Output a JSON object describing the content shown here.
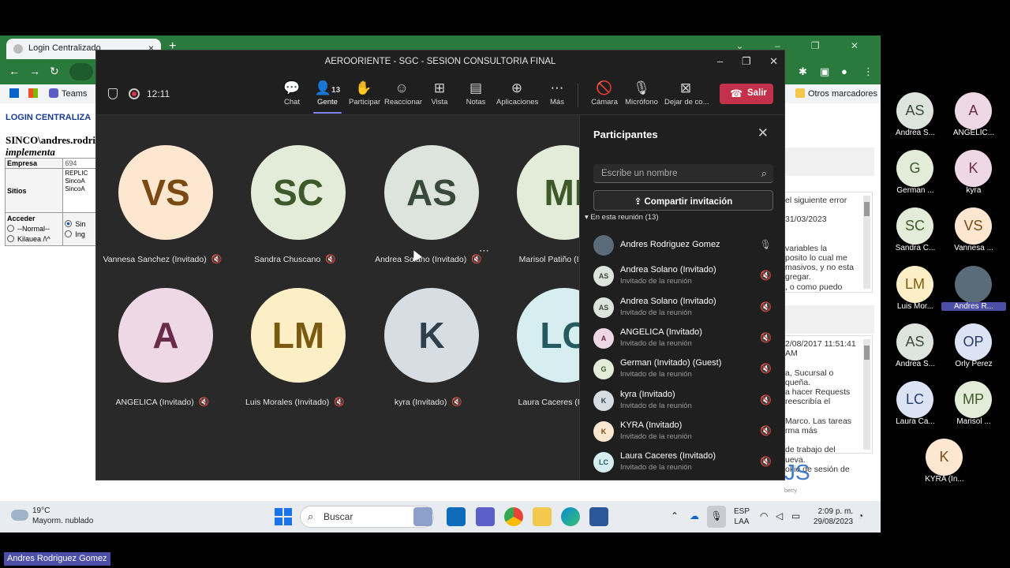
{
  "browser": {
    "tab_title": "Login Centralizado",
    "tab_close": "×",
    "new_tab": "+",
    "bookmarks": {
      "teams": "Teams",
      "otros": "Otros marcadores"
    }
  },
  "page": {
    "login_title": "LOGIN CENTRALIZA",
    "user_line": "SINCO\\andres.rodri",
    "implementa": "implementa",
    "empresa_label": "Empresa",
    "empresa_value": "694",
    "sitios_label": "Sitios",
    "sitios_values": [
      "REPLIC",
      "SincoA",
      "SincoA"
    ],
    "acceder_label": "Acceder",
    "opt_normal": "--Normal--",
    "opt_kilauea": "Kilauea /\\^",
    "opt_sin": "Sin",
    "opt_ing": "Ing",
    "right_text_1": [
      "el siguiente error",
      "",
      "31/03/2023",
      "",
      "",
      "variables la",
      "posito lo cual me",
      "masivos, y no esta",
      "gregar.",
      ", o como puedo"
    ],
    "right_text_2": [
      "2/08/2017 11:51:41 AM",
      "",
      "a, Sucursal o",
      "queña.",
      "a hacer Requests",
      "reescribía el",
      "",
      "Marco. Las tareas",
      "rma más",
      "",
      "de trabajo del",
      "ueva.",
      "okie de sesión de"
    ],
    "logo_fragment": "JS",
    "logo_sub": "berry"
  },
  "taskbar": {
    "weather_temp": "19°C",
    "weather_desc": "Mayorm. nublado",
    "search_label": "Buscar",
    "lang_1": "ESP",
    "lang_2": "LAA",
    "time": "2:09 p. m.",
    "date": "29/08/2023"
  },
  "teams": {
    "window_title": "AEROORIENTE - SGC - SESION CONSULTORIA FINAL",
    "timer": "12:11",
    "people_count": "13",
    "toolbar": {
      "chat": "Chat",
      "gente": "Gente",
      "participar": "Participar",
      "reaccionar": "Reaccionar",
      "vista": "Vista",
      "notas": "Notas",
      "aplicaciones": "Aplicaciones",
      "mas": "Más",
      "camara": "Cámara",
      "microfono": "Micrófono",
      "dejar": "Dejar de co...",
      "salir": "Salir"
    },
    "tiles": [
      {
        "initials": "VS",
        "name": "Vannesa Sanchez (Invitado)",
        "bg": "#fde7d0",
        "fg": "#7a4a12"
      },
      {
        "initials": "SC",
        "name": "Sandra Chuscano",
        "bg": "#e3ecd9",
        "fg": "#3f5a2a"
      },
      {
        "initials": "AS",
        "name": "Andrea Solano (Invitado)",
        "bg": "#dde4dd",
        "fg": "#3a4a3a"
      },
      {
        "initials": "MI",
        "name": "Marisol Patiño (Inv",
        "bg": "#e3ecd9",
        "fg": "#3f5a2a"
      },
      {
        "initials": "A",
        "name": "ANGELICA (Invitado)",
        "bg": "#efd8e6",
        "fg": "#6a2a4a"
      },
      {
        "initials": "LM",
        "name": "Luis Morales (Invitado)",
        "bg": "#fcefc6",
        "fg": "#7a5a10"
      },
      {
        "initials": "K",
        "name": "kyra (Invitado)",
        "bg": "#d6dde3",
        "fg": "#2f3f4c"
      },
      {
        "initials": "LC",
        "name": "Laura Caceres (Inv",
        "bg": "#d7eef0",
        "fg": "#245a60"
      }
    ],
    "panel": {
      "title": "Participantes",
      "search_placeholder": "Escribe un nombre",
      "invite": "Compartir invitación",
      "in_meeting": "En esta reunión (13)",
      "role": "Invitado de la reunión",
      "participants": [
        {
          "initials": "",
          "name": "Andres Rodriguez Gomez",
          "show_role": false,
          "bg": "#5a6b7a",
          "fg": "#fff",
          "muted": false
        },
        {
          "initials": "AS",
          "name": "Andrea Solano (Invitado)",
          "show_role": true,
          "bg": "#dde4dd",
          "fg": "#3a4a3a",
          "muted": true
        },
        {
          "initials": "AS",
          "name": "Andrea Solano (Invitado)",
          "show_role": true,
          "bg": "#dde4dd",
          "fg": "#3a4a3a",
          "muted": true
        },
        {
          "initials": "A",
          "name": "ANGELICA (Invitado)",
          "show_role": true,
          "bg": "#efd8e6",
          "fg": "#6a2a4a",
          "muted": true
        },
        {
          "initials": "G",
          "name": "German (Invitado) (Guest)",
          "show_role": true,
          "bg": "#e3ecd9",
          "fg": "#3f5a2a",
          "muted": true
        },
        {
          "initials": "K",
          "name": "kyra (Invitado)",
          "show_role": true,
          "bg": "#d6dde3",
          "fg": "#2f3f4c",
          "muted": true
        },
        {
          "initials": "K",
          "name": "KYRA (Invitado)",
          "show_role": true,
          "bg": "#fde7d0",
          "fg": "#7a4a12",
          "muted": true
        },
        {
          "initials": "LC",
          "name": "Laura Caceres (Invitado)",
          "show_role": true,
          "bg": "#d7eef0",
          "fg": "#245a60",
          "muted": true
        }
      ]
    }
  },
  "gallery": [
    {
      "initials": "AS",
      "label": "Andrea S...",
      "bg": "#dde4dd",
      "fg": "#3a4a3a",
      "active": false
    },
    {
      "initials": "A",
      "label": "ANGELIC...",
      "bg": "#efd8e6",
      "fg": "#6a2a4a",
      "active": false
    },
    {
      "initials": "G",
      "label": "German ...",
      "bg": "#e3ecd9",
      "fg": "#3f5a2a",
      "active": false
    },
    {
      "initials": "K",
      "label": "kyra",
      "bg": "#efd8e6",
      "fg": "#6a2a4a",
      "active": false
    },
    {
      "initials": "SC",
      "label": "Sandra C...",
      "bg": "#e3ecd9",
      "fg": "#3f5a2a",
      "active": false
    },
    {
      "initials": "VS",
      "label": "Vannesa ...",
      "bg": "#fde7d0",
      "fg": "#7a4a12",
      "active": false
    },
    {
      "initials": "LM",
      "label": "Luis Mor...",
      "bg": "#fcefc6",
      "fg": "#7a5a10",
      "active": false
    },
    {
      "initials": "",
      "label": "Andres R...",
      "bg": "#5a6b7a",
      "fg": "#fff",
      "active": true
    },
    {
      "initials": "AS",
      "label": "Andrea S...",
      "bg": "#dde4dd",
      "fg": "#3a4a3a",
      "active": false
    },
    {
      "initials": "OP",
      "label": "Orly Perez",
      "bg": "#dbe3f4",
      "fg": "#2a3a6a",
      "active": false
    },
    {
      "initials": "LC",
      "label": "Laura Ca...",
      "bg": "#dbe3f4",
      "fg": "#2a3a6a",
      "active": false
    },
    {
      "initials": "MP",
      "label": "Marisol ...",
      "bg": "#e3ecd9",
      "fg": "#3f5a2a",
      "active": false
    },
    {
      "initials": "K",
      "label": "KYRA (In...",
      "bg": "#fde7d0",
      "fg": "#7a4a12",
      "active": false
    }
  ],
  "bottom_name": "Andres Rodriguez Gomez"
}
